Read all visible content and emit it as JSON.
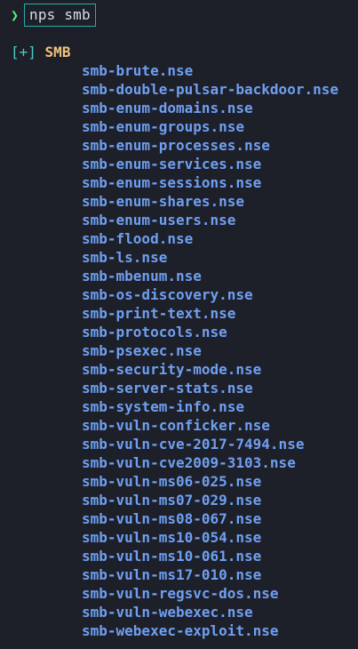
{
  "terminal": {
    "prompt_symbol": "❯",
    "command": "nps smb"
  },
  "section": {
    "marker": "[+]",
    "name": "SMB"
  },
  "scripts": [
    "smb-brute.nse",
    "smb-double-pulsar-backdoor.nse",
    "smb-enum-domains.nse",
    "smb-enum-groups.nse",
    "smb-enum-processes.nse",
    "smb-enum-services.nse",
    "smb-enum-sessions.nse",
    "smb-enum-shares.nse",
    "smb-enum-users.nse",
    "smb-flood.nse",
    "smb-ls.nse",
    "smb-mbenum.nse",
    "smb-os-discovery.nse",
    "smb-print-text.nse",
    "smb-protocols.nse",
    "smb-psexec.nse",
    "smb-security-mode.nse",
    "smb-server-stats.nse",
    "smb-system-info.nse",
    "smb-vuln-conficker.nse",
    "smb-vuln-cve-2017-7494.nse",
    "smb-vuln-cve2009-3103.nse",
    "smb-vuln-ms06-025.nse",
    "smb-vuln-ms07-029.nse",
    "smb-vuln-ms08-067.nse",
    "smb-vuln-ms10-054.nse",
    "smb-vuln-ms10-061.nse",
    "smb-vuln-ms17-010.nse",
    "smb-vuln-regsvc-dos.nse",
    "smb-vuln-webexec.nse",
    "smb-webexec-exploit.nse"
  ],
  "colors": {
    "background": "#1e2029",
    "prompt_arrow": "#50fa7b",
    "command_box_border": "#2aa9a3",
    "command_text": "#d8dee9",
    "bracket": "#50c8c8",
    "section_name": "#f1c27d",
    "script_name": "#6f9ff2"
  }
}
